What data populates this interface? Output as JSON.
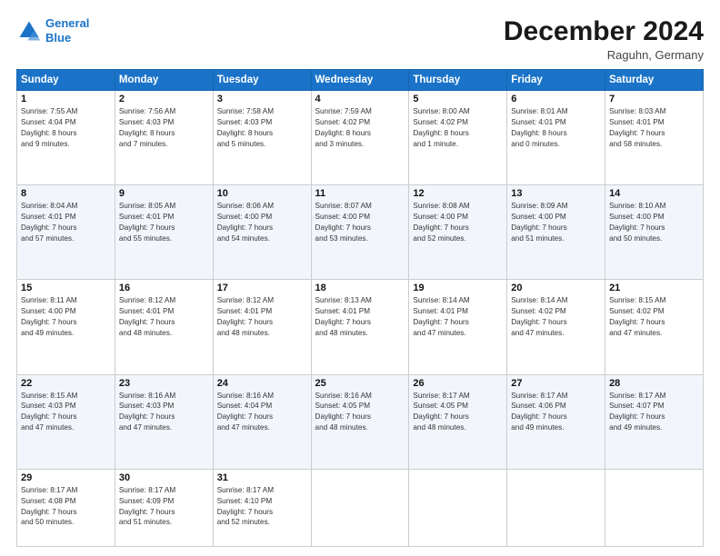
{
  "header": {
    "logo_line1": "General",
    "logo_line2": "Blue",
    "month": "December 2024",
    "location": "Raguhn, Germany"
  },
  "weekdays": [
    "Sunday",
    "Monday",
    "Tuesday",
    "Wednesday",
    "Thursday",
    "Friday",
    "Saturday"
  ],
  "weeks": [
    [
      {
        "day": "1",
        "sunrise": "Sunrise: 7:55 AM",
        "sunset": "Sunset: 4:04 PM",
        "daylight": "Daylight: 8 hours and 9 minutes."
      },
      {
        "day": "2",
        "sunrise": "Sunrise: 7:56 AM",
        "sunset": "Sunset: 4:03 PM",
        "daylight": "Daylight: 8 hours and 7 minutes."
      },
      {
        "day": "3",
        "sunrise": "Sunrise: 7:58 AM",
        "sunset": "Sunset: 4:03 PM",
        "daylight": "Daylight: 8 hours and 5 minutes."
      },
      {
        "day": "4",
        "sunrise": "Sunrise: 7:59 AM",
        "sunset": "Sunset: 4:02 PM",
        "daylight": "Daylight: 8 hours and 3 minutes."
      },
      {
        "day": "5",
        "sunrise": "Sunrise: 8:00 AM",
        "sunset": "Sunset: 4:02 PM",
        "daylight": "Daylight: 8 hours and 1 minute."
      },
      {
        "day": "6",
        "sunrise": "Sunrise: 8:01 AM",
        "sunset": "Sunset: 4:01 PM",
        "daylight": "Daylight: 8 hours and 0 minutes."
      },
      {
        "day": "7",
        "sunrise": "Sunrise: 8:03 AM",
        "sunset": "Sunset: 4:01 PM",
        "daylight": "Daylight: 7 hours and 58 minutes."
      }
    ],
    [
      {
        "day": "8",
        "sunrise": "Sunrise: 8:04 AM",
        "sunset": "Sunset: 4:01 PM",
        "daylight": "Daylight: 7 hours and 57 minutes."
      },
      {
        "day": "9",
        "sunrise": "Sunrise: 8:05 AM",
        "sunset": "Sunset: 4:01 PM",
        "daylight": "Daylight: 7 hours and 55 minutes."
      },
      {
        "day": "10",
        "sunrise": "Sunrise: 8:06 AM",
        "sunset": "Sunset: 4:00 PM",
        "daylight": "Daylight: 7 hours and 54 minutes."
      },
      {
        "day": "11",
        "sunrise": "Sunrise: 8:07 AM",
        "sunset": "Sunset: 4:00 PM",
        "daylight": "Daylight: 7 hours and 53 minutes."
      },
      {
        "day": "12",
        "sunrise": "Sunrise: 8:08 AM",
        "sunset": "Sunset: 4:00 PM",
        "daylight": "Daylight: 7 hours and 52 minutes."
      },
      {
        "day": "13",
        "sunrise": "Sunrise: 8:09 AM",
        "sunset": "Sunset: 4:00 PM",
        "daylight": "Daylight: 7 hours and 51 minutes."
      },
      {
        "day": "14",
        "sunrise": "Sunrise: 8:10 AM",
        "sunset": "Sunset: 4:00 PM",
        "daylight": "Daylight: 7 hours and 50 minutes."
      }
    ],
    [
      {
        "day": "15",
        "sunrise": "Sunrise: 8:11 AM",
        "sunset": "Sunset: 4:00 PM",
        "daylight": "Daylight: 7 hours and 49 minutes."
      },
      {
        "day": "16",
        "sunrise": "Sunrise: 8:12 AM",
        "sunset": "Sunset: 4:01 PM",
        "daylight": "Daylight: 7 hours and 48 minutes."
      },
      {
        "day": "17",
        "sunrise": "Sunrise: 8:12 AM",
        "sunset": "Sunset: 4:01 PM",
        "daylight": "Daylight: 7 hours and 48 minutes."
      },
      {
        "day": "18",
        "sunrise": "Sunrise: 8:13 AM",
        "sunset": "Sunset: 4:01 PM",
        "daylight": "Daylight: 7 hours and 48 minutes."
      },
      {
        "day": "19",
        "sunrise": "Sunrise: 8:14 AM",
        "sunset": "Sunset: 4:01 PM",
        "daylight": "Daylight: 7 hours and 47 minutes."
      },
      {
        "day": "20",
        "sunrise": "Sunrise: 8:14 AM",
        "sunset": "Sunset: 4:02 PM",
        "daylight": "Daylight: 7 hours and 47 minutes."
      },
      {
        "day": "21",
        "sunrise": "Sunrise: 8:15 AM",
        "sunset": "Sunset: 4:02 PM",
        "daylight": "Daylight: 7 hours and 47 minutes."
      }
    ],
    [
      {
        "day": "22",
        "sunrise": "Sunrise: 8:15 AM",
        "sunset": "Sunset: 4:03 PM",
        "daylight": "Daylight: 7 hours and 47 minutes."
      },
      {
        "day": "23",
        "sunrise": "Sunrise: 8:16 AM",
        "sunset": "Sunset: 4:03 PM",
        "daylight": "Daylight: 7 hours and 47 minutes."
      },
      {
        "day": "24",
        "sunrise": "Sunrise: 8:16 AM",
        "sunset": "Sunset: 4:04 PM",
        "daylight": "Daylight: 7 hours and 47 minutes."
      },
      {
        "day": "25",
        "sunrise": "Sunrise: 8:16 AM",
        "sunset": "Sunset: 4:05 PM",
        "daylight": "Daylight: 7 hours and 48 minutes."
      },
      {
        "day": "26",
        "sunrise": "Sunrise: 8:17 AM",
        "sunset": "Sunset: 4:05 PM",
        "daylight": "Daylight: 7 hours and 48 minutes."
      },
      {
        "day": "27",
        "sunrise": "Sunrise: 8:17 AM",
        "sunset": "Sunset: 4:06 PM",
        "daylight": "Daylight: 7 hours and 49 minutes."
      },
      {
        "day": "28",
        "sunrise": "Sunrise: 8:17 AM",
        "sunset": "Sunset: 4:07 PM",
        "daylight": "Daylight: 7 hours and 49 minutes."
      }
    ],
    [
      {
        "day": "29",
        "sunrise": "Sunrise: 8:17 AM",
        "sunset": "Sunset: 4:08 PM",
        "daylight": "Daylight: 7 hours and 50 minutes."
      },
      {
        "day": "30",
        "sunrise": "Sunrise: 8:17 AM",
        "sunset": "Sunset: 4:09 PM",
        "daylight": "Daylight: 7 hours and 51 minutes."
      },
      {
        "day": "31",
        "sunrise": "Sunrise: 8:17 AM",
        "sunset": "Sunset: 4:10 PM",
        "daylight": "Daylight: 7 hours and 52 minutes."
      },
      null,
      null,
      null,
      null
    ]
  ]
}
